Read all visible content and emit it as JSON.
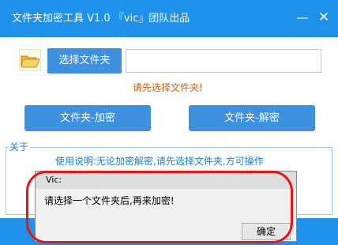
{
  "window": {
    "title": "文件夹加密工具 V1.0 『vic』团队出品",
    "minimize_glyph": "—",
    "close_glyph": "✕"
  },
  "toolbar": {
    "folder_icon": "folder-icon",
    "select_button_label": "选择文件夹",
    "path_value": "",
    "hint": "请先选择文件夹!"
  },
  "actions": {
    "encrypt_label": "文件夹-加密",
    "decrypt_label": "文件夹-解密"
  },
  "about": {
    "legend": "关于",
    "instructions": "使用说明:无论加密解密,请先选择文件夹,方可操作"
  },
  "dialog": {
    "title": "Vic:",
    "message": "请选择一个文件夹后,再来加密!",
    "ok_label": "确定"
  },
  "colors": {
    "titlebar": "#1e91eb",
    "button": "#3d91e0",
    "hint": "#e06000",
    "about_text": "#1e7fd8",
    "annotation_ring": "#e81515"
  }
}
